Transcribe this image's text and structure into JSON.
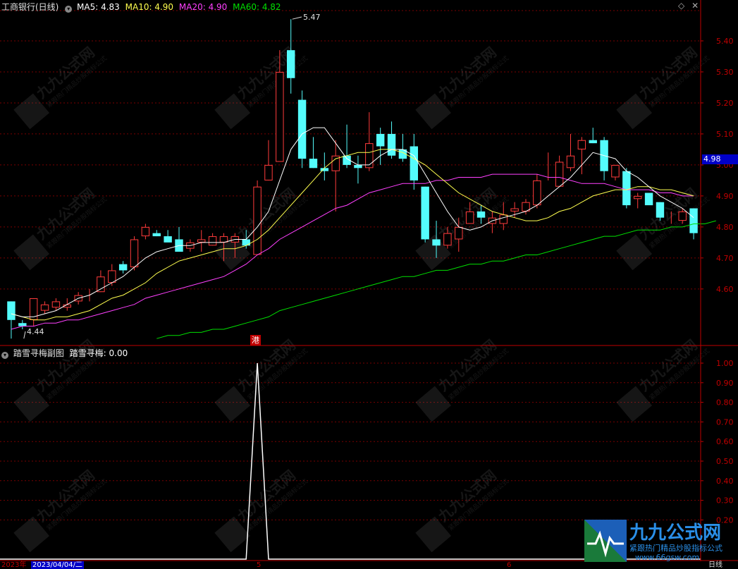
{
  "header": {
    "stock_name": "工商银行(日线)",
    "ma5_label": "MA5: 4.83",
    "ma10_label": "MA10: 4.90",
    "ma20_label": "MA20: 4.90",
    "ma60_label": "MA60: 4.82",
    "current_price": "4.98",
    "high_annotation": "5.47",
    "low_annotation": "4.44",
    "event_tag": "港"
  },
  "sub_header": {
    "title": "踏雪寻梅副图",
    "indicator": "踏雪寻梅: 0.00"
  },
  "footer": {
    "date_label": "2023/04/04/二",
    "year_label": "2023年",
    "month_5": "5",
    "month_6": "6",
    "period_label": "日线"
  },
  "watermark": {
    "brand": "九九公式网",
    "slogan": "紧跟热门精品炒股指标公式",
    "url": "www.66gsw.com"
  },
  "colors": {
    "up": "#ff3b3b",
    "down": "#54fcfc",
    "ma5": "#ffffff",
    "ma10": "#ffff4f",
    "ma20": "#ff40ff",
    "ma60": "#00e000",
    "grid": "#7a0000",
    "axis": "#c00000"
  },
  "chart_data": [
    {
      "type": "candlestick",
      "title": "工商银行(日线)",
      "y_ticks": [
        5.4,
        5.3,
        5.2,
        5.1,
        5.0,
        4.9,
        4.8,
        4.7,
        4.6
      ],
      "ylim": [
        4.42,
        5.5
      ],
      "candles": [
        {
          "o": 4.56,
          "h": 4.56,
          "l": 4.44,
          "c": 4.5
        },
        {
          "o": 4.49,
          "h": 4.5,
          "l": 4.47,
          "c": 4.48
        },
        {
          "o": 4.5,
          "h": 4.57,
          "l": 4.48,
          "c": 4.57
        },
        {
          "o": 4.53,
          "h": 4.56,
          "l": 4.52,
          "c": 4.55
        },
        {
          "o": 4.54,
          "h": 4.57,
          "l": 4.53,
          "c": 4.56
        },
        {
          "o": 4.54,
          "h": 4.57,
          "l": 4.53,
          "c": 4.55
        },
        {
          "o": 4.56,
          "h": 4.59,
          "l": 4.55,
          "c": 4.58
        },
        {
          "o": 4.58,
          "h": 4.6,
          "l": 4.56,
          "c": 4.58
        },
        {
          "o": 4.59,
          "h": 4.66,
          "l": 4.59,
          "c": 4.64
        },
        {
          "o": 4.62,
          "h": 4.68,
          "l": 4.61,
          "c": 4.66
        },
        {
          "o": 4.68,
          "h": 4.69,
          "l": 4.65,
          "c": 4.66
        },
        {
          "o": 4.67,
          "h": 4.77,
          "l": 4.66,
          "c": 4.76
        },
        {
          "o": 4.77,
          "h": 4.81,
          "l": 4.76,
          "c": 4.8
        },
        {
          "o": 4.78,
          "h": 4.79,
          "l": 4.77,
          "c": 4.77
        },
        {
          "o": 4.77,
          "h": 4.79,
          "l": 4.76,
          "c": 4.75
        },
        {
          "o": 4.76,
          "h": 4.8,
          "l": 4.72,
          "c": 4.72
        },
        {
          "o": 4.73,
          "h": 4.76,
          "l": 4.72,
          "c": 4.75
        },
        {
          "o": 4.75,
          "h": 4.79,
          "l": 4.72,
          "c": 4.76
        },
        {
          "o": 4.74,
          "h": 4.78,
          "l": 4.74,
          "c": 4.77
        },
        {
          "o": 4.75,
          "h": 4.78,
          "l": 4.69,
          "c": 4.77
        },
        {
          "o": 4.75,
          "h": 4.78,
          "l": 4.7,
          "c": 4.77
        },
        {
          "o": 4.76,
          "h": 4.79,
          "l": 4.73,
          "c": 4.74
        },
        {
          "o": 4.71,
          "h": 4.95,
          "l": 4.71,
          "c": 4.93
        },
        {
          "o": 4.95,
          "h": 5.08,
          "l": 4.95,
          "c": 5.0
        },
        {
          "o": 5.01,
          "h": 5.37,
          "l": 5.01,
          "c": 5.3
        },
        {
          "o": 5.37,
          "h": 5.47,
          "l": 5.23,
          "c": 5.28
        },
        {
          "o": 5.21,
          "h": 5.24,
          "l": 4.99,
          "c": 5.02
        },
        {
          "o": 5.02,
          "h": 5.09,
          "l": 4.99,
          "c": 4.99
        },
        {
          "o": 4.99,
          "h": 5.04,
          "l": 4.95,
          "c": 4.98
        },
        {
          "o": 4.98,
          "h": 5.08,
          "l": 4.85,
          "c": 5.03
        },
        {
          "o": 5.03,
          "h": 5.13,
          "l": 4.99,
          "c": 5.0
        },
        {
          "o": 5.0,
          "h": 5.03,
          "l": 4.94,
          "c": 4.99
        },
        {
          "o": 4.99,
          "h": 5.17,
          "l": 4.98,
          "c": 5.07
        },
        {
          "o": 5.1,
          "h": 5.12,
          "l": 5.0,
          "c": 5.06
        },
        {
          "o": 5.1,
          "h": 5.14,
          "l": 5.02,
          "c": 5.03
        },
        {
          "o": 5.05,
          "h": 5.1,
          "l": 5.01,
          "c": 5.02
        },
        {
          "o": 5.06,
          "h": 5.1,
          "l": 4.92,
          "c": 4.95
        },
        {
          "o": 4.93,
          "h": 4.93,
          "l": 4.75,
          "c": 4.76
        },
        {
          "o": 4.76,
          "h": 4.82,
          "l": 4.7,
          "c": 4.74
        },
        {
          "o": 4.74,
          "h": 4.8,
          "l": 4.73,
          "c": 4.78
        },
        {
          "o": 4.76,
          "h": 4.83,
          "l": 4.72,
          "c": 4.8
        },
        {
          "o": 4.81,
          "h": 4.88,
          "l": 4.81,
          "c": 4.85
        },
        {
          "o": 4.85,
          "h": 4.87,
          "l": 4.81,
          "c": 4.83
        },
        {
          "o": 4.81,
          "h": 4.85,
          "l": 4.78,
          "c": 4.83
        },
        {
          "o": 4.81,
          "h": 4.88,
          "l": 4.79,
          "c": 4.84
        },
        {
          "o": 4.85,
          "h": 4.88,
          "l": 4.83,
          "c": 4.86
        },
        {
          "o": 4.85,
          "h": 4.89,
          "l": 4.84,
          "c": 4.88
        },
        {
          "o": 4.87,
          "h": 4.97,
          "l": 4.86,
          "c": 4.95
        },
        {
          "o": 4.95,
          "h": 5.04,
          "l": 4.95,
          "c": 4.95
        },
        {
          "o": 4.93,
          "h": 5.03,
          "l": 4.93,
          "c": 5.01
        },
        {
          "o": 4.99,
          "h": 5.1,
          "l": 4.98,
          "c": 5.03
        },
        {
          "o": 5.05,
          "h": 5.09,
          "l": 4.97,
          "c": 5.08
        },
        {
          "o": 5.08,
          "h": 5.12,
          "l": 5.07,
          "c": 5.07
        },
        {
          "o": 5.08,
          "h": 5.09,
          "l": 4.95,
          "c": 4.98
        },
        {
          "o": 4.96,
          "h": 5.0,
          "l": 4.95,
          "c": 5.0
        },
        {
          "o": 4.98,
          "h": 4.99,
          "l": 4.86,
          "c": 4.87
        },
        {
          "o": 4.89,
          "h": 4.91,
          "l": 4.86,
          "c": 4.9
        },
        {
          "o": 4.91,
          "h": 4.91,
          "l": 4.88,
          "c": 4.87
        },
        {
          "o": 4.88,
          "h": 4.88,
          "l": 4.82,
          "c": 4.83
        },
        {
          "o": 4.83,
          "h": 4.85,
          "l": 4.81,
          "c": 4.83
        },
        {
          "o": 4.82,
          "h": 4.86,
          "l": 4.81,
          "c": 4.85
        },
        {
          "o": 4.86,
          "h": 4.86,
          "l": 4.76,
          "c": 4.78
        }
      ],
      "ma5": [
        4.52,
        4.51,
        4.51,
        4.52,
        4.53,
        4.55,
        4.57,
        4.58,
        4.6,
        4.62,
        4.64,
        4.67,
        4.7,
        4.72,
        4.73,
        4.74,
        4.74,
        4.75,
        4.75,
        4.75,
        4.76,
        4.76,
        4.8,
        4.85,
        4.95,
        5.05,
        5.1,
        5.12,
        5.12,
        5.07,
        5.02,
        5.0,
        5.0,
        5.03,
        5.05,
        5.05,
        5.03,
        4.97,
        4.91,
        4.85,
        4.8,
        4.79,
        4.8,
        4.82,
        4.83,
        4.84,
        4.85,
        4.87,
        4.9,
        4.93,
        4.96,
        5.0,
        5.04,
        5.03,
        5.02,
        4.98,
        4.96,
        4.93,
        4.9,
        4.88,
        4.86,
        4.83
      ],
      "ma10": [
        4.52,
        4.51,
        4.5,
        4.5,
        4.51,
        4.51,
        4.52,
        4.53,
        4.55,
        4.57,
        4.58,
        4.6,
        4.62,
        4.65,
        4.67,
        4.69,
        4.7,
        4.71,
        4.72,
        4.73,
        4.73,
        4.74,
        4.76,
        4.79,
        4.83,
        4.87,
        4.91,
        4.95,
        4.99,
        5.02,
        5.03,
        5.04,
        5.04,
        5.05,
        5.05,
        5.04,
        5.02,
        5.0,
        4.97,
        4.94,
        4.91,
        4.89,
        4.87,
        4.85,
        4.84,
        4.83,
        4.82,
        4.82,
        4.83,
        4.85,
        4.86,
        4.88,
        4.9,
        4.91,
        4.92,
        4.92,
        4.93,
        4.93,
        4.92,
        4.92,
        4.91,
        4.9
      ],
      "ma20": [
        4.47,
        4.48,
        4.48,
        4.49,
        4.49,
        4.5,
        4.5,
        4.51,
        4.52,
        4.53,
        4.54,
        4.55,
        4.57,
        4.58,
        4.59,
        4.6,
        4.61,
        4.62,
        4.63,
        4.64,
        4.66,
        4.68,
        4.71,
        4.73,
        4.76,
        4.78,
        4.8,
        4.82,
        4.84,
        4.86,
        4.87,
        4.89,
        4.91,
        4.92,
        4.93,
        4.94,
        4.94,
        4.94,
        4.95,
        4.95,
        4.96,
        4.96,
        4.96,
        4.97,
        4.97,
        4.97,
        4.97,
        4.97,
        4.96,
        4.96,
        4.95,
        4.94,
        4.94,
        4.94,
        4.93,
        4.92,
        4.92,
        4.92,
        4.91,
        4.91,
        4.9,
        4.9
      ],
      "ma60_start": 13,
      "ma60": [
        4.44,
        4.45,
        4.45,
        4.46,
        4.46,
        4.47,
        4.47,
        4.48,
        4.49,
        4.5,
        4.51,
        4.53,
        4.54,
        4.55,
        4.56,
        4.57,
        4.58,
        4.59,
        4.6,
        4.61,
        4.62,
        4.63,
        4.64,
        4.64,
        4.65,
        4.66,
        4.66,
        4.67,
        4.68,
        4.68,
        4.69,
        4.69,
        4.7,
        4.71,
        4.71,
        4.72,
        4.73,
        4.74,
        4.75,
        4.76,
        4.77,
        4.77,
        4.78,
        4.79,
        4.79,
        4.79,
        4.8,
        4.8,
        4.81,
        4.81,
        4.82
      ]
    },
    {
      "type": "line",
      "title": "踏雪寻梅副图",
      "y_ticks": [
        1.0,
        0.9,
        0.8,
        0.7,
        0.6,
        0.5,
        0.4,
        0.3,
        0.2
      ],
      "ylim": [
        0.0,
        1.0
      ],
      "values": [
        0,
        0,
        0,
        0,
        0,
        0,
        0,
        0,
        0,
        0,
        0,
        0,
        0,
        0,
        0,
        0,
        0,
        0,
        0,
        0,
        0,
        0,
        1,
        0,
        0,
        0,
        0,
        0,
        0,
        0,
        0,
        0,
        0,
        0,
        0,
        0,
        0,
        0,
        0,
        0,
        0,
        0,
        0,
        0,
        0,
        0,
        0,
        0,
        0,
        0,
        0,
        0,
        0,
        0,
        0,
        0,
        0,
        0,
        0,
        0,
        0,
        0
      ]
    }
  ]
}
